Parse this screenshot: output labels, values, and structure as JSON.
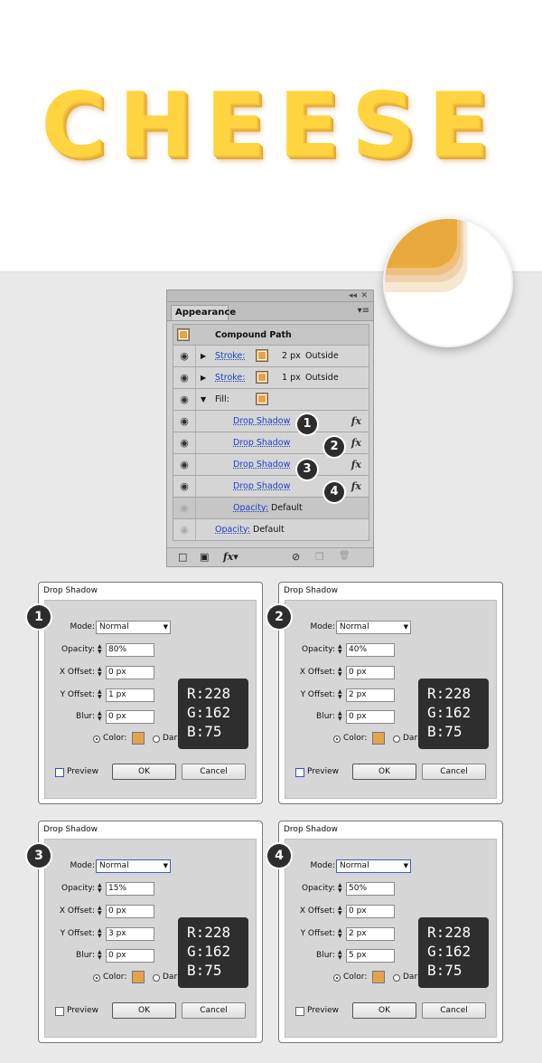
{
  "artwork": {
    "text": "CHEESE"
  },
  "appearance_panel": {
    "tab": "Appearance",
    "collapse_glyph": "◂◂",
    "close_glyph": "✕",
    "menu_glyph": "▾≡",
    "object": "Compound Path",
    "rows": [
      {
        "label": "Stroke:",
        "value": "2 px",
        "mode": "Outside"
      },
      {
        "label": "Stroke:",
        "value": "1 px",
        "mode": "Outside"
      },
      {
        "label": "Fill:"
      },
      {
        "label": "Drop Shadow",
        "badge": "1"
      },
      {
        "label": "Drop Shadow",
        "badge": "2"
      },
      {
        "label": "Drop Shadow",
        "badge": "3"
      },
      {
        "label": "Drop Shadow",
        "badge": "4"
      },
      {
        "label": "Opacity:",
        "value": "Default"
      },
      {
        "label": "Opacity:",
        "value": "Default"
      }
    ],
    "fx": "fx",
    "eye_icon": "◉",
    "bottom": {
      "new_stroke": "□",
      "new_fill": "▣",
      "fx_menu": "fx▾",
      "clear": "⊘",
      "duplicate": "❐",
      "delete": "🗑"
    }
  },
  "dialogs": [
    {
      "badge": "1",
      "title": "Drop Shadow",
      "mode": "Normal",
      "opacity": "80%",
      "x_offset": "0 px",
      "y_offset": "1 px",
      "blur": "0 px",
      "color_label": "Color:",
      "dark_label": "Dark",
      "preview": "Preview",
      "ok": "OK",
      "cancel": "Cancel",
      "rgb": {
        "r": "R:228",
        "g": "G:162",
        "b": "B:75"
      }
    },
    {
      "badge": "2",
      "title": "Drop Shadow",
      "mode": "Normal",
      "opacity": "40%",
      "x_offset": "0 px",
      "y_offset": "2 px",
      "blur": "0 px",
      "color_label": "Color:",
      "dark_label": "Dark",
      "preview": "Preview",
      "ok": "OK",
      "cancel": "Cancel",
      "rgb": {
        "r": "R:228",
        "g": "G:162",
        "b": "B:75"
      }
    },
    {
      "badge": "3",
      "title": "Drop Shadow",
      "mode": "Normal",
      "opacity": "15%",
      "x_offset": "0 px",
      "y_offset": "3 px",
      "blur": "0 px",
      "color_label": "Color:",
      "dark_label": "Dark",
      "preview": "Preview",
      "ok": "OK",
      "cancel": "Cancel",
      "rgb": {
        "r": "R:228",
        "g": "G:162",
        "b": "B:75"
      }
    },
    {
      "badge": "4",
      "title": "Drop Shadow",
      "mode": "Normal",
      "opacity": "50%",
      "x_offset": "0 px",
      "y_offset": "2 px",
      "blur": "5 px",
      "color_label": "Color:",
      "dark_label": "Dark",
      "preview": "Preview",
      "ok": "OK",
      "cancel": "Cancel",
      "rgb": {
        "r": "R:228",
        "g": "G:162",
        "b": "B:75"
      }
    }
  ],
  "field_labels": {
    "mode": "Mode:",
    "opacity": "Opacity:",
    "x_offset": "X Offset:",
    "y_offset": "Y Offset:",
    "blur": "Blur:"
  },
  "colors": {
    "shadow": "#e4a24b",
    "cheese": "#ffd440"
  }
}
